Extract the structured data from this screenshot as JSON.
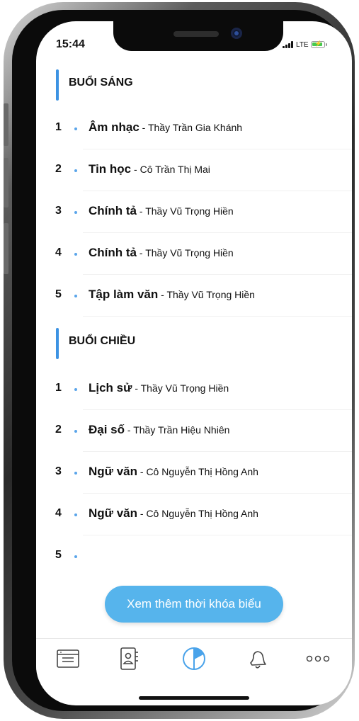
{
  "status_bar": {
    "time": "15:44",
    "network": "LTE"
  },
  "morning": {
    "title": "BUỔI SÁNG",
    "rows": [
      {
        "num": "1",
        "subject": "Âm nhạc",
        "teacher": " - Thầy Trần Gia Khánh"
      },
      {
        "num": "2",
        "subject": "Tin học",
        "teacher": " - Cô Trần Thị Mai"
      },
      {
        "num": "3",
        "subject": "Chính tả",
        "teacher": " - Thầy Vũ Trọng Hiền"
      },
      {
        "num": "4",
        "subject": "Chính tả",
        "teacher": " - Thầy Vũ Trọng Hiền"
      },
      {
        "num": "5",
        "subject": "Tập làm văn",
        "teacher": " - Thầy Vũ Trọng Hiền"
      }
    ]
  },
  "afternoon": {
    "title": "BUỔI CHIỀU",
    "rows": [
      {
        "num": "1",
        "subject": "Lịch sử",
        "teacher": " - Thầy Vũ Trọng Hiền"
      },
      {
        "num": "2",
        "subject": "Đại số",
        "teacher": " - Thầy Trần Hiệu Nhiên"
      },
      {
        "num": "3",
        "subject": "Ngữ văn",
        "teacher": " - Cô Nguyễn Thị Hồng Anh"
      },
      {
        "num": "4",
        "subject": "Ngữ văn",
        "teacher": " - Cô Nguyễn Thị Hồng Anh"
      },
      {
        "num": "5",
        "subject": "",
        "teacher": ""
      }
    ]
  },
  "more_button": {
    "label": "Xem thêm thời khóa biểu"
  },
  "tabs": [
    {
      "icon": "news-icon",
      "active": false
    },
    {
      "icon": "contacts-icon",
      "active": false
    },
    {
      "icon": "schedule-icon",
      "active": true
    },
    {
      "icon": "bell-icon",
      "active": false
    },
    {
      "icon": "more-icon",
      "active": false
    }
  ],
  "colors": {
    "accent": "#3d93e3",
    "button": "#56b4ec",
    "text": "#111111"
  }
}
